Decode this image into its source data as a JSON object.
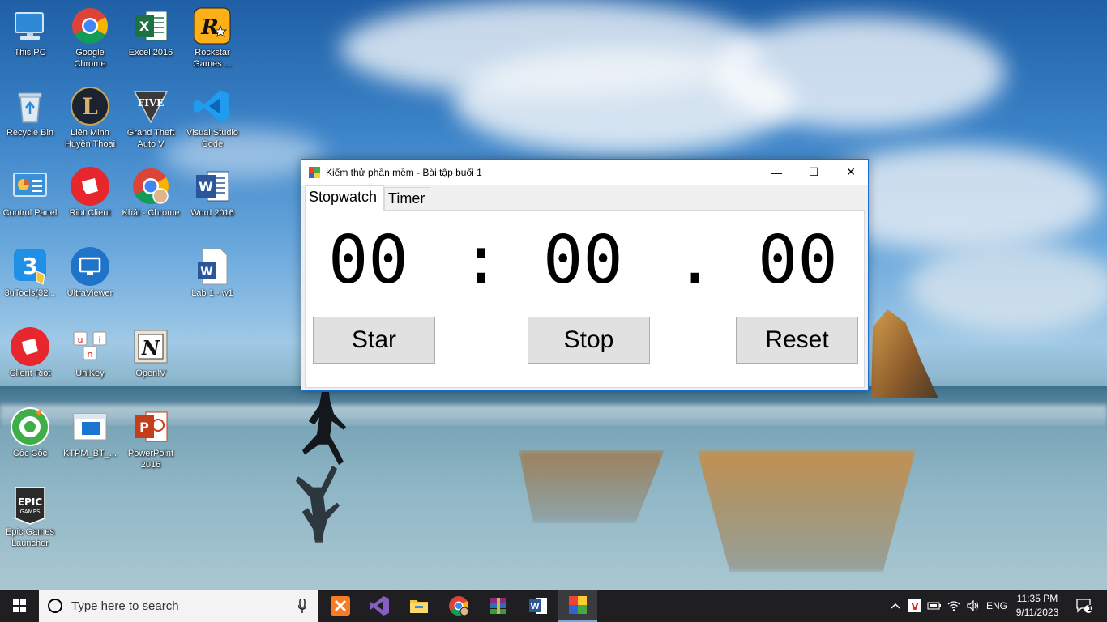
{
  "window": {
    "title": "Kiểm thử phần mềm - Bài tập buổi 1",
    "controls": {
      "minimize": "—",
      "maximize": "☐",
      "close": "✕"
    }
  },
  "tabs": [
    {
      "label": "Stopwatch",
      "active": true
    },
    {
      "label": "Timer",
      "active": false
    }
  ],
  "stopwatch": {
    "minutes": "00",
    "separator1": ":",
    "seconds": "00",
    "separator2": ".",
    "centiseconds": "00",
    "buttons": {
      "start": "Star",
      "stop": "Stop",
      "reset": "Reset"
    }
  },
  "desktop_icons": [
    {
      "label": "This PC",
      "icon": "computer-icon"
    },
    {
      "label": "Google Chrome",
      "icon": "chrome-icon"
    },
    {
      "label": "Excel 2016",
      "icon": "excel-icon"
    },
    {
      "label": "Rockstar Games ...",
      "icon": "rockstar-icon"
    },
    {
      "label": "Recycle Bin",
      "icon": "recycle-bin-icon"
    },
    {
      "label": "Liên Minh Huyền Thoại",
      "icon": "league-icon"
    },
    {
      "label": "Grand Theft Auto V",
      "icon": "gta-icon"
    },
    {
      "label": "Visual Studio Code",
      "icon": "vscode-icon"
    },
    {
      "label": "Control Panel",
      "icon": "control-panel-icon"
    },
    {
      "label": "Riot Client",
      "icon": "riot-icon"
    },
    {
      "label": "Khải - Chrome",
      "icon": "chrome-profile-icon"
    },
    {
      "label": "Word 2016",
      "icon": "word-icon"
    },
    {
      "label": "3uTools(32...",
      "icon": "3utools-icon"
    },
    {
      "label": "UltraViewer",
      "icon": "ultraviewer-icon"
    },
    {
      "label": "Lab 1 - w1",
      "icon": "word-doc-icon"
    },
    {
      "label": "Client Riot",
      "icon": "riot-icon"
    },
    {
      "label": "UniKey",
      "icon": "unikey-icon"
    },
    {
      "label": "OpenIV",
      "icon": "openiv-icon"
    },
    {
      "label": "Cốc Cốc",
      "icon": "coccoc-icon"
    },
    {
      "label": "KTPM_BT_...",
      "icon": "app-shortcut-icon"
    },
    {
      "label": "PowerPoint 2016",
      "icon": "powerpoint-icon"
    },
    {
      "label": "Epic Games Launcher",
      "icon": "epic-games-icon"
    }
  ],
  "taskbar": {
    "search_placeholder": "Type here to search",
    "apps": [
      "xampp-icon",
      "visual-studio-icon",
      "file-explorer-icon",
      "chrome-icon",
      "winrar-icon",
      "word-icon",
      "stopwatch-app-icon"
    ],
    "tray": {
      "language": "ENG",
      "time": "11:35 PM",
      "date": "9/11/2023",
      "notification_count": "1"
    }
  },
  "colors": {
    "window_border": "#1b6fd1",
    "button_bg": "#e1e1e1",
    "taskbar_bg": "#1f1f22"
  }
}
